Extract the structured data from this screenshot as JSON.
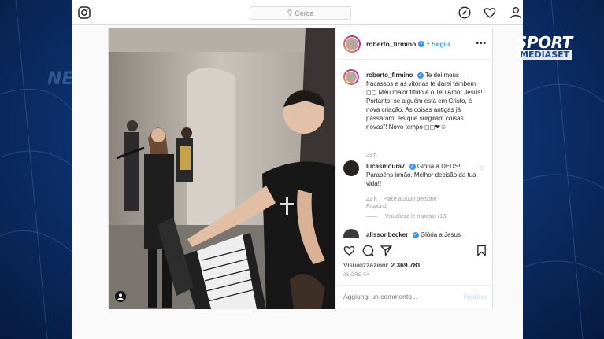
{
  "search": {
    "placeholder": "Cerca"
  },
  "post": {
    "username": "roberto_firmino",
    "follow_label": "Segui",
    "more_label": "•••",
    "caption_author": "roberto_firmino",
    "caption_text": "Te dei meus fracassos e as vitórias te darei também ◻◻ Meu maior título é o Teu Amor Jesus!",
    "caption_text_2": "Portanto, se alguém está em Cristo, é nova criação. As coisas antigas já passaram; eis que surgiram coisas novas\"! Novo tempo ◻◻❤☺",
    "caption_time": "23 h",
    "comments": [
      {
        "author": "lucasmoura7",
        "text": "Glória a DEUS!! Parabéns irmão. Melhor decisão da tua vida!!",
        "time": "22 h",
        "likes": "Piace a 2030 persone",
        "reply": "Rispondi",
        "view_replies": "Visualizza le risposte (13)"
      },
      {
        "author": "alissonbecker",
        "text": "Glória a Jesus"
      }
    ],
    "views_label": "Visualizzazioni:",
    "views_count": "2.369.781",
    "time_ago": "23 ORE FA",
    "comment_placeholder": "Aggiungi un commento...",
    "publish_label": "Pubblica"
  },
  "broadcast": {
    "brand_top": "SPORT",
    "brand_bottom": "MEDIASET",
    "ghost_text": "NE"
  },
  "colors": {
    "accent": "#3897f0",
    "background": "#0d2f6a"
  }
}
